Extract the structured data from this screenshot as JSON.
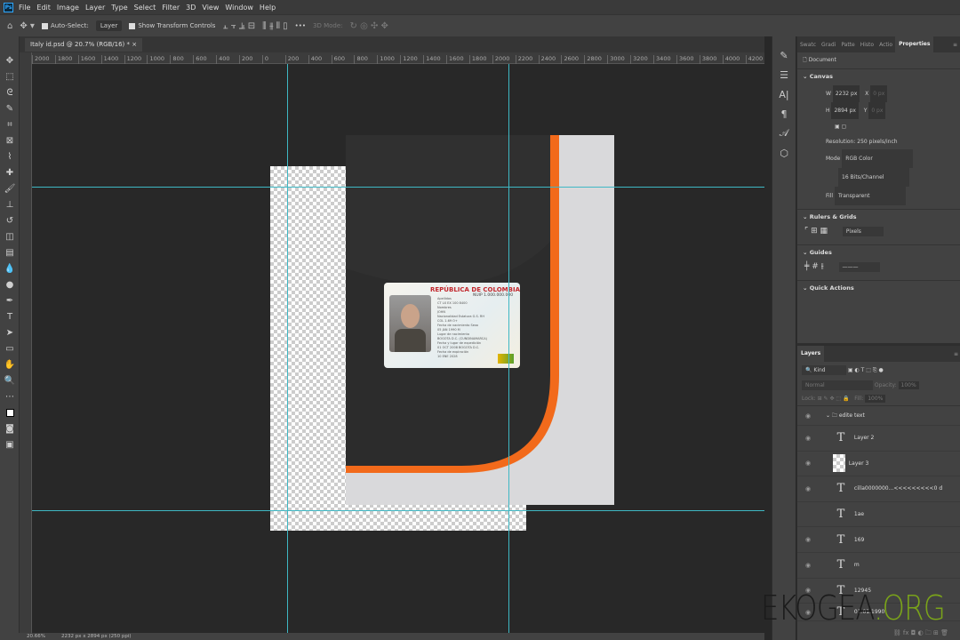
{
  "menu": [
    "File",
    "Edit",
    "Image",
    "Layer",
    "Type",
    "Select",
    "Filter",
    "3D",
    "View",
    "Window",
    "Help"
  ],
  "app_logo": "Ps",
  "options": {
    "auto_select": "Auto-Select:",
    "auto_select_target": "Layer",
    "transform": "Show Transform Controls",
    "mode_3d": "3D Mode:",
    "more": "•••"
  },
  "document_tab": "Italy id.psd @ 20.7% (RGB/16) *",
  "ruler_labels": [
    "2000",
    "1800",
    "1600",
    "1400",
    "1200",
    "1000",
    "800",
    "600",
    "400",
    "200",
    "0",
    "200",
    "400",
    "600",
    "800",
    "1000",
    "1200",
    "1400",
    "1600",
    "1800",
    "2000",
    "2200",
    "2400",
    "2600",
    "2800",
    "3000",
    "3200",
    "3400",
    "3600",
    "3800",
    "4000",
    "4200"
  ],
  "card": {
    "title": "REPÚBLICA DE COLOMBIA",
    "number": "NUIP 1.000.000.000",
    "fields": [
      "Apellidos",
      "CT LX EX 100   8400",
      "Nombres",
      "JOHN",
      "Nacionalidad  Estatura  G.S. RH",
      "COL  1.69  O+",
      "Fecha de nacimiento  Sexo",
      "05 JAN 1990  M",
      "Lugar de nacimiento",
      "BOGOTA D.C. (CUNDINAMARCA)",
      "Fecha y lugar de expedición",
      "01 OCT 2008  BOGOTA D.C.",
      "Fecha de expiración",
      "10 ENE 2028"
    ]
  },
  "status": {
    "zoom": "20.66%",
    "doc_info": "2232 px x 2894 px (250 ppi)"
  },
  "properties": {
    "tabs": [
      "Swatc",
      "Gradi",
      "Patte",
      "Histo",
      "Actio",
      "Properties"
    ],
    "active_tab": "Properties",
    "doc_label": "Document",
    "canvas_title": "Canvas",
    "w_label": "W",
    "w": "2232 px",
    "h_label": "H",
    "h": "2894 px",
    "x_label": "X",
    "x": "0 px",
    "y_label": "Y",
    "y": "0 px",
    "resolution": "Resolution: 250 pixels/inch",
    "mode_label": "Mode",
    "mode": "RGB Color",
    "depth": "16 Bits/Channel",
    "fill_label": "Fill",
    "fill": "Transparent",
    "rulers_title": "Rulers & Grids",
    "units": "Pixels",
    "guides_title": "Guides",
    "quick_actions": "Quick Actions"
  },
  "layers": {
    "title": "Layers",
    "kind": "Kind",
    "blend": "Normal",
    "opacity_label": "Opacity:",
    "opacity": "100%",
    "lock_label": "Lock:",
    "fill_label": "Fill:",
    "fill": "100%",
    "items": [
      {
        "name": "edite text",
        "type": "group",
        "visible": true
      },
      {
        "name": "Layer 2",
        "type": "text",
        "visible": true
      },
      {
        "name": "Layer 3",
        "type": "image",
        "visible": true
      },
      {
        "name": "cilla0000000...<<<<<<<<<0 d",
        "type": "text",
        "visible": true
      },
      {
        "name": "1ae",
        "type": "text",
        "visible": false
      },
      {
        "name": "169",
        "type": "text",
        "visible": true
      },
      {
        "name": "m",
        "type": "text",
        "visible": true
      },
      {
        "name": "12945",
        "type": "text",
        "visible": true
      },
      {
        "name": "01.01.1990",
        "type": "text",
        "visible": true
      }
    ]
  },
  "watermark": {
    "a": "EKOGEA",
    "b": ".ORG"
  },
  "colors": {
    "guide": "#3fb8c4",
    "orange": "#f26a1b",
    "watermark_green": "#7aa31a",
    "card_red": "#c1272d"
  }
}
